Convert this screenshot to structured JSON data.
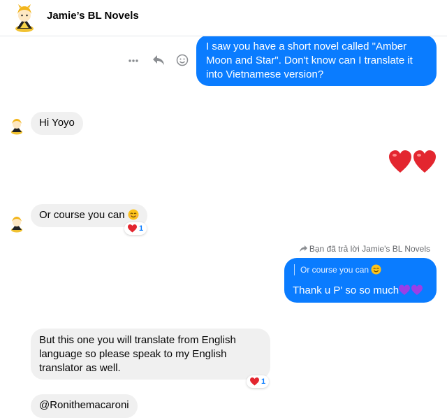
{
  "header": {
    "title": "Jamie’s BL Novels"
  },
  "messages": {
    "m1": "I saw you have a short novel called \"Amber Moon and Star\". Don't know can I translate it into Vietnamese version?",
    "m2": "Hi Yoyo",
    "m3": "Or course you can",
    "m3_reaction_count": "1",
    "reply_note": "Bạn đã trả lời Jamie's BL Novels",
    "m4_quote": "Or course you can",
    "m4": "Thank u P' so  so much",
    "m5": "But this one you will translate from English language so please speak to my English translator as well.",
    "m5_reaction_count": "1",
    "m6": "@Ronithemacaroni"
  },
  "icons": {
    "more": "more-dots-icon",
    "reply": "reply-arrow-icon",
    "react": "smiley-react-icon",
    "reaction": "red-heart-emoji",
    "hearts": "red-heart-emoji",
    "purple": "purple-heart-emoji",
    "smile": "smiling-face-emoji",
    "reply_note": "reply-forward-arrow-icon"
  },
  "colors": {
    "outgoing_bubble": "#0a7cff",
    "incoming_bubble": "#f0f0f0",
    "heart": "#e3262f",
    "purple_heart": "#9b3fe6"
  }
}
